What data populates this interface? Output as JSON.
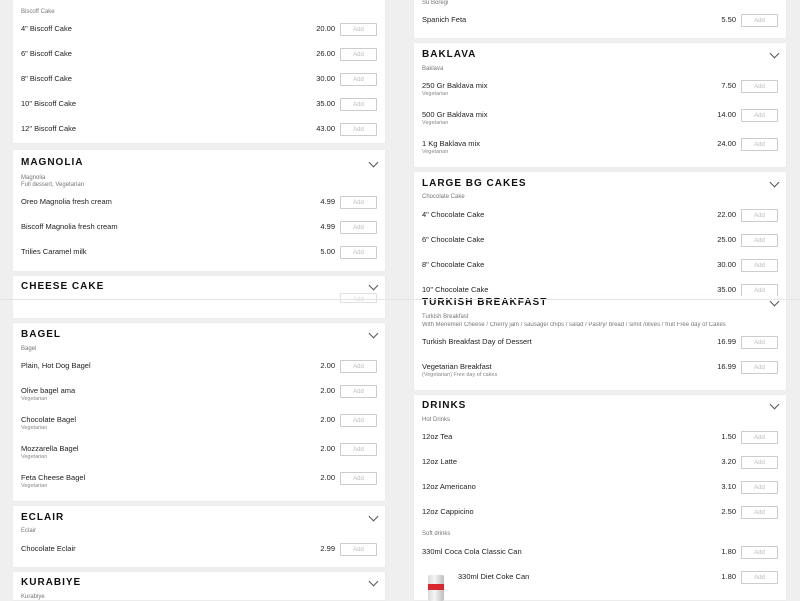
{
  "left": {
    "biscuit": {
      "subtitle": "Biscoff Cake",
      "items": [
        {
          "name": "4\" Biscoff Cake",
          "price": "20.00"
        },
        {
          "name": "6\" Biscoff Cake",
          "price": "26.00"
        },
        {
          "name": "8\" Biscoff Cake",
          "price": "30.00"
        },
        {
          "name": "10\" Biscoff Cake",
          "price": "35.00"
        },
        {
          "name": "12\" Biscoff Cake",
          "price": "43.00"
        }
      ]
    },
    "magnolia": {
      "title": "MAGNOLIA",
      "subtitle": "Magnolia",
      "subtitle2": "Full dessert, Vegetarian",
      "items": [
        {
          "name": "Oreo Magnolia fresh cream",
          "price": "4.99"
        },
        {
          "name": "Biscoff Magnolia fresh cream",
          "price": "4.99"
        },
        {
          "name": "Trilies Caramel milk",
          "price": "5.00"
        }
      ]
    },
    "cheesecake": {
      "title": "CHEESE CAKE"
    },
    "bagel": {
      "title": "BAGEL",
      "subtitle": "Bagel",
      "items": [
        {
          "name": "Plain, Hot Dog Bagel",
          "price": "2.00",
          "tag": ""
        },
        {
          "name": "Olive bagel ama",
          "price": "2.00",
          "tag": "Vegetarian"
        },
        {
          "name": "Chocolate Bagel",
          "price": "2.00",
          "tag": "Vegetarian"
        },
        {
          "name": "Mozzarella Bagel",
          "price": "2.00",
          "tag": "Vegetarian"
        },
        {
          "name": "Feta Cheese Bagel",
          "price": "2.00",
          "tag": "Vegetarian"
        }
      ]
    },
    "eclair": {
      "title": "ECLAIR",
      "subtitle": "Eclair",
      "items": [
        {
          "name": "Chocolate Eclair",
          "price": "2.99"
        }
      ]
    },
    "kurabiye": {
      "title": "KURABIYE",
      "subtitle": "Kurabiye"
    }
  },
  "right": {
    "borek": {
      "subtitle": "Su Boregi",
      "items": [
        {
          "name": "Spanich Feta",
          "price": "5.50"
        }
      ]
    },
    "baklava": {
      "title": "BAKLAVA",
      "subtitle": "Baklava",
      "items": [
        {
          "name": "250 Gr Baklava mix",
          "price": "7.50",
          "tag": "Vegetarian"
        },
        {
          "name": "500 Gr Baklava mix",
          "price": "14.00",
          "tag": "Vegetarian"
        },
        {
          "name": "1 Kg Baklava mix",
          "price": "24.00",
          "tag": "Vegetarian"
        }
      ]
    },
    "largebg": {
      "title": "LARGE BG CAKES",
      "subtitle": "Chocolate Cake",
      "items": [
        {
          "name": "4\" Chocolate Cake",
          "price": "22.00"
        },
        {
          "name": "6\" Chocolate Cake",
          "price": "25.00"
        },
        {
          "name": "8\" Chocolate Cake",
          "price": "30.00"
        },
        {
          "name": "10\" Chocolate Cake",
          "price": "35.00"
        }
      ]
    },
    "turkish": {
      "title": "TURKISH BREAKFAST",
      "subtitle": "Turkish Breakfast",
      "subtitle2": "With Menemen Cheese / Cherry jam / sausage/ chips / salad / Pastry/ bread / simit /olives / fruit Free day of Cakes",
      "items": [
        {
          "name": "Turkish Breakfast Day of Dessert",
          "price": "16.99",
          "tag": ""
        },
        {
          "name": "Vegetarian Breakfast",
          "price": "16.99",
          "tag": "(Vegetarian) Free day of cakes"
        }
      ]
    },
    "drinks": {
      "title": "DRINKS",
      "hot_subtitle": "Hot Drinks",
      "hot_items": [
        {
          "name": "12oz Tea",
          "price": "1.50"
        },
        {
          "name": "12oz Latte",
          "price": "3.20"
        },
        {
          "name": "12oz Americano",
          "price": "3.10"
        },
        {
          "name": "12oz Cappicino",
          "price": "2.50"
        }
      ],
      "soft_subtitle": "Soft drinks",
      "soft_items": [
        {
          "name": "330ml Coca Cola Classic Can",
          "price": "1.80"
        },
        {
          "name": "330ml Diet Coke Can",
          "price": "1.80"
        }
      ]
    }
  },
  "add_label": "Add",
  "icons": {
    "chevron": "chevron-down-icon",
    "can": "diet-coke-can-icon"
  },
  "colors": {
    "background": "#efefef",
    "card": "#ffffff",
    "add_border": "#cccccc",
    "add_text": "#bbbbbb"
  }
}
